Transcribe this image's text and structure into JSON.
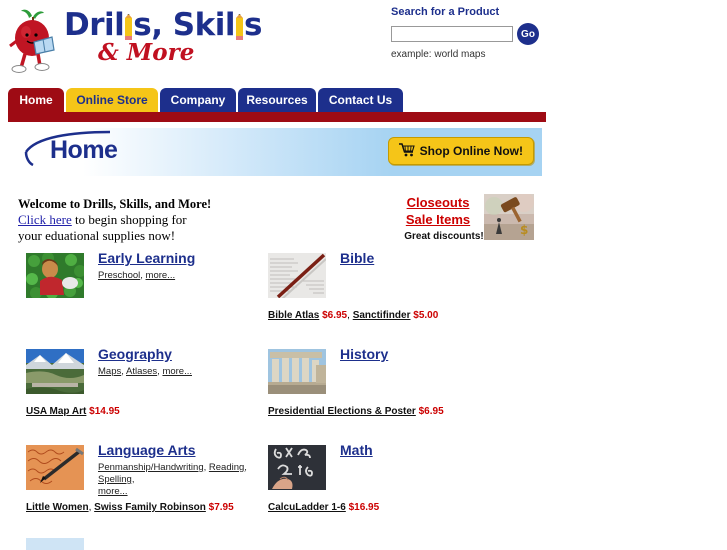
{
  "brand": {
    "name_line1_a": "Dril",
    "name_line1_b": "s, Skil",
    "name_line1_c": "s",
    "name_line2": "& More",
    "mascot_alt": "apple-reading-book-mascot"
  },
  "search": {
    "label": "Search for a Product",
    "value": "",
    "placeholder": "",
    "button_label": "Go",
    "example": "example: world maps"
  },
  "nav": {
    "tabs": [
      {
        "label": "Home",
        "style": "red",
        "active": true
      },
      {
        "label": "Online Store",
        "style": "gold",
        "active": false
      },
      {
        "label": "Company",
        "style": "blue",
        "active": false
      },
      {
        "label": "Resources",
        "style": "blue",
        "active": false
      },
      {
        "label": "Contact Us",
        "style": "blue",
        "active": false
      }
    ]
  },
  "banner": {
    "title": "Home",
    "shop_button": "Shop Online Now!",
    "cart_icon": "shopping-cart-icon"
  },
  "welcome": {
    "heading": "Welcome to Drills, Skills, and More!",
    "link": "Click here",
    "text_after_link": " to begin shopping for",
    "line3": "your eduational supplies now!"
  },
  "closeouts": {
    "link1": "Closeouts",
    "link2": "Sale Items",
    "subtitle": "Great discounts!",
    "image_alt": "auction-gavel-image"
  },
  "categories": [
    {
      "title": "Early Learning",
      "subs": [
        "Preschool",
        "more..."
      ],
      "thumb": "child-in-ball-pit-photo",
      "products": []
    },
    {
      "title": "Bible",
      "subs": [],
      "thumb": "open-bible-page-photo",
      "products": [
        {
          "name": "Bible Atlas",
          "price": "$6.95",
          "sep": ","
        },
        {
          "name": "Sanctifinder",
          "price": "$5.00",
          "sep": ""
        }
      ]
    },
    {
      "title": "Geography ",
      "subs": [
        "Maps",
        "Atlases",
        "more..."
      ],
      "thumb": "mountain-bridge-landscape-photo",
      "products": [
        {
          "name": "USA Map Art",
          "price": "$14.95",
          "sep": ""
        }
      ]
    },
    {
      "title": "History",
      "subs": [],
      "thumb": "roman-columns-ruins-photo",
      "products": [
        {
          "name": "Presidential Elections & Poster",
          "price": "$6.95",
          "sep": ""
        }
      ]
    },
    {
      "title": "Language Arts ",
      "subs": [
        "Penmanship/Handwriting",
        "Reading",
        "Spelling",
        "more..."
      ],
      "thumb": "handwriting-with-pen-photo",
      "products": [
        {
          "name": "Little Women",
          "price": "",
          "sep": ","
        },
        {
          "name": "Swiss Family Robinson",
          "price": "$7.95",
          "sep": ""
        }
      ]
    },
    {
      "title": "Math",
      "subs": [],
      "thumb": "chalkboard-equations-photo",
      "products": [
        {
          "name": "CalcuLadder 1-6",
          "price": "$16.95",
          "sep": ""
        }
      ]
    }
  ],
  "colors": {
    "brand_blue": "#1d2f8c",
    "brand_red": "#9e0b14",
    "accent_gold": "#f5c518",
    "price_red": "#cc0000",
    "banner_blue": "#a6d3f2"
  }
}
